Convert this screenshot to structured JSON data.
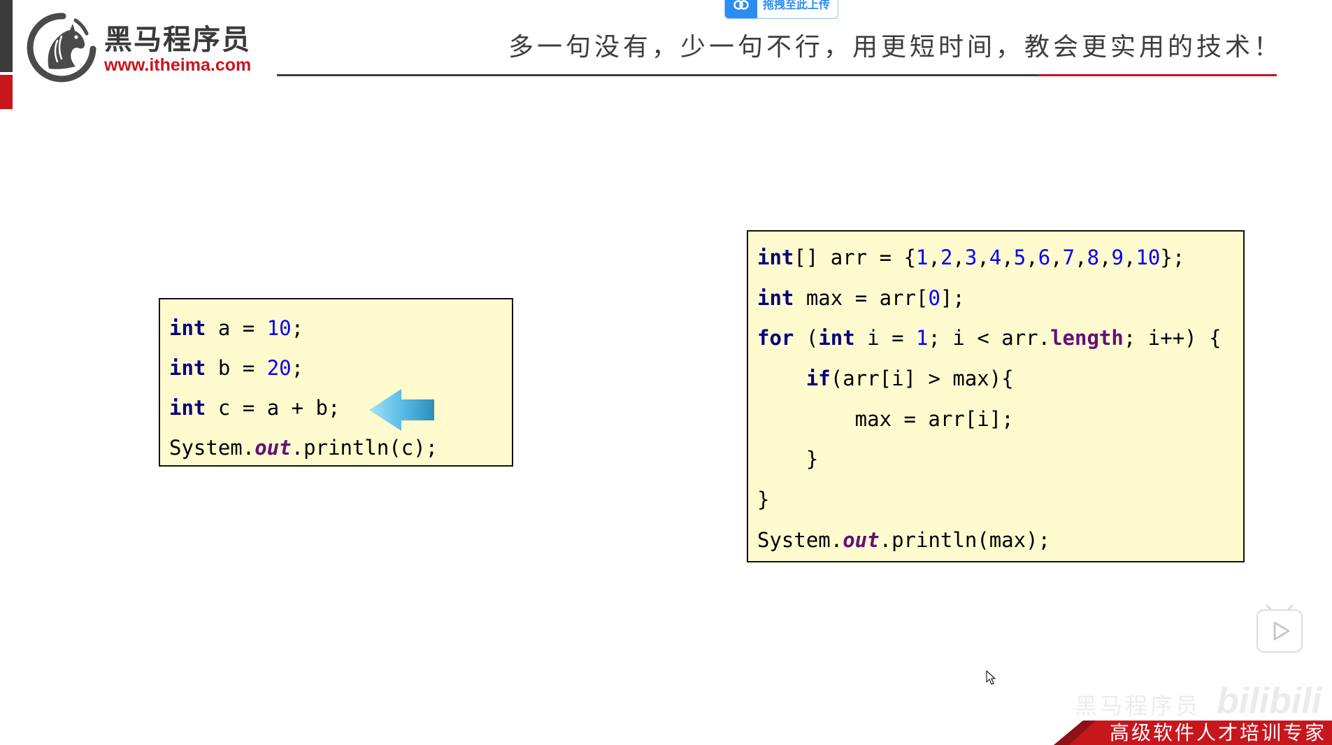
{
  "theme": {
    "accent": "#C8161D",
    "code_background": "#FFFBCF",
    "upload_blue": "#2B8CF4",
    "slogan_color": "#3D3D3D"
  },
  "brand": {
    "name": "黑马程序员",
    "url_text": "www.itheima.com",
    "logo_icon": "horse-head-logo-icon"
  },
  "upload_button": {
    "label": "拖拽至此上传",
    "icon": "link-icon"
  },
  "slogan": "多一句没有，少一句不行，用更短时间，教会更实用的技术！",
  "syntax_colors": {
    "keyword": "#000080",
    "number": "#0000FF",
    "static-field": "#660E7A",
    "field": "#660E7A",
    "plain": "#000000"
  },
  "left_code": {
    "lines": [
      {
        "tokens": [
          {
            "t": "int",
            "k": "keyword"
          },
          {
            "t": " a = ",
            "k": "plain"
          },
          {
            "t": "10",
            "k": "number"
          },
          {
            "t": ";",
            "k": "plain"
          }
        ]
      },
      {
        "tokens": [
          {
            "t": "int",
            "k": "keyword"
          },
          {
            "t": " b = ",
            "k": "plain"
          },
          {
            "t": "20",
            "k": "number"
          },
          {
            "t": ";",
            "k": "plain"
          }
        ]
      },
      {
        "tokens": [
          {
            "t": "int",
            "k": "keyword"
          },
          {
            "t": " c = a + b;",
            "k": "plain"
          }
        ]
      },
      {
        "tokens": [
          {
            "t": "System.",
            "k": "plain"
          },
          {
            "t": "out",
            "k": "static-field"
          },
          {
            "t": ".println(c);",
            "k": "plain"
          }
        ]
      }
    ]
  },
  "left_code_marker_icon": "left-arrow-icon",
  "right_code": {
    "lines": [
      {
        "tokens": [
          {
            "t": "int",
            "k": "keyword"
          },
          {
            "t": "[] arr = {",
            "k": "plain"
          },
          {
            "t": "1",
            "k": "number"
          },
          {
            "t": ",",
            "k": "plain"
          },
          {
            "t": "2",
            "k": "number"
          },
          {
            "t": ",",
            "k": "plain"
          },
          {
            "t": "3",
            "k": "number"
          },
          {
            "t": ",",
            "k": "plain"
          },
          {
            "t": "4",
            "k": "number"
          },
          {
            "t": ",",
            "k": "plain"
          },
          {
            "t": "5",
            "k": "number"
          },
          {
            "t": ",",
            "k": "plain"
          },
          {
            "t": "6",
            "k": "number"
          },
          {
            "t": ",",
            "k": "plain"
          },
          {
            "t": "7",
            "k": "number"
          },
          {
            "t": ",",
            "k": "plain"
          },
          {
            "t": "8",
            "k": "number"
          },
          {
            "t": ",",
            "k": "plain"
          },
          {
            "t": "9",
            "k": "number"
          },
          {
            "t": ",",
            "k": "plain"
          },
          {
            "t": "10",
            "k": "number"
          },
          {
            "t": "};",
            "k": "plain"
          }
        ]
      },
      {
        "tokens": [
          {
            "t": "int",
            "k": "keyword"
          },
          {
            "t": " max = arr[",
            "k": "plain"
          },
          {
            "t": "0",
            "k": "number"
          },
          {
            "t": "];",
            "k": "plain"
          }
        ]
      },
      {
        "tokens": [
          {
            "t": "for",
            "k": "keyword"
          },
          {
            "t": " (",
            "k": "plain"
          },
          {
            "t": "int",
            "k": "keyword"
          },
          {
            "t": " i = ",
            "k": "plain"
          },
          {
            "t": "1",
            "k": "number"
          },
          {
            "t": "; i < arr.",
            "k": "plain"
          },
          {
            "t": "length",
            "k": "field"
          },
          {
            "t": "; i++) {",
            "k": "plain"
          }
        ]
      },
      {
        "tokens": [
          {
            "t": "    ",
            "k": "plain"
          },
          {
            "t": "if",
            "k": "keyword"
          },
          {
            "t": "(arr[i] > max){",
            "k": "plain"
          }
        ]
      },
      {
        "tokens": [
          {
            "t": "        max = arr[i];",
            "k": "plain"
          }
        ]
      },
      {
        "tokens": [
          {
            "t": "    }",
            "k": "plain"
          }
        ]
      },
      {
        "tokens": [
          {
            "t": "}",
            "k": "plain"
          }
        ]
      },
      {
        "tokens": [
          {
            "t": "System.",
            "k": "plain"
          },
          {
            "t": "out",
            "k": "static-field"
          },
          {
            "t": ".println(max);",
            "k": "plain"
          }
        ]
      }
    ]
  },
  "player": {
    "play_button_icon": "play-icon",
    "cursor_icon": "mouse-pointer-icon"
  },
  "watermarks": {
    "brand": "黑马程序员",
    "platform": "bilibili"
  },
  "footer_banner": {
    "text": "高级软件人才培训专家"
  }
}
